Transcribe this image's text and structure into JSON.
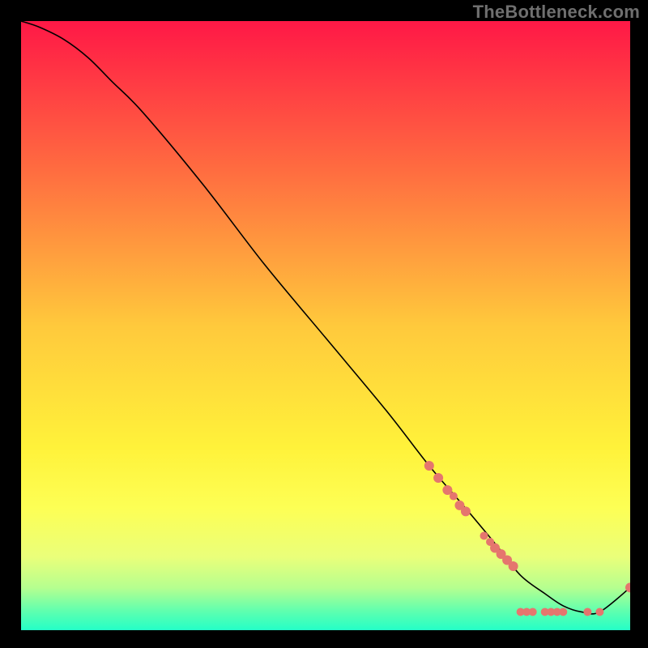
{
  "watermark": "TheBottleneck.com",
  "chart_data": {
    "type": "line",
    "title": "",
    "xlabel": "",
    "ylabel": "",
    "xlim": [
      0,
      100
    ],
    "ylim": [
      0,
      100
    ],
    "grid": false,
    "legend": false,
    "gradient_stops": [
      {
        "offset": 0.0,
        "color": "#ff1846"
      },
      {
        "offset": 0.25,
        "color": "#ff6e40"
      },
      {
        "offset": 0.5,
        "color": "#ffc93c"
      },
      {
        "offset": 0.7,
        "color": "#fff23a"
      },
      {
        "offset": 0.8,
        "color": "#fdff55"
      },
      {
        "offset": 0.88,
        "color": "#eaff7a"
      },
      {
        "offset": 0.93,
        "color": "#b6ff8f"
      },
      {
        "offset": 0.97,
        "color": "#5cffb0"
      },
      {
        "offset": 1.0,
        "color": "#24ffc7"
      }
    ],
    "series": [
      {
        "name": "bottleneck-curve",
        "color": "#000000",
        "x": [
          0,
          3,
          7,
          11,
          15,
          20,
          30,
          40,
          50,
          60,
          67,
          73,
          78,
          82,
          86,
          89,
          92,
          95,
          100
        ],
        "y": [
          100,
          99,
          97,
          94,
          90,
          85,
          73,
          60,
          48,
          36,
          27,
          20,
          14,
          9,
          6,
          4,
          3,
          3,
          7
        ]
      }
    ],
    "markers": {
      "name": "highlighted-points",
      "color": "#e5766e",
      "radius_small": 5,
      "radius_large": 6,
      "points": [
        {
          "x": 67.0,
          "y": 27.0,
          "r": "large"
        },
        {
          "x": 68.5,
          "y": 25.0,
          "r": "large"
        },
        {
          "x": 70.0,
          "y": 23.0,
          "r": "large"
        },
        {
          "x": 71.0,
          "y": 22.0,
          "r": "small"
        },
        {
          "x": 72.0,
          "y": 20.5,
          "r": "large"
        },
        {
          "x": 73.0,
          "y": 19.5,
          "r": "large"
        },
        {
          "x": 76.0,
          "y": 15.5,
          "r": "small"
        },
        {
          "x": 77.0,
          "y": 14.5,
          "r": "small"
        },
        {
          "x": 77.8,
          "y": 13.5,
          "r": "large"
        },
        {
          "x": 78.8,
          "y": 12.5,
          "r": "large"
        },
        {
          "x": 79.8,
          "y": 11.5,
          "r": "large"
        },
        {
          "x": 80.8,
          "y": 10.5,
          "r": "large"
        },
        {
          "x": 82.0,
          "y": 3.0,
          "r": "small"
        },
        {
          "x": 83.0,
          "y": 3.0,
          "r": "small"
        },
        {
          "x": 84.0,
          "y": 3.0,
          "r": "small"
        },
        {
          "x": 86.0,
          "y": 3.0,
          "r": "small"
        },
        {
          "x": 87.0,
          "y": 3.0,
          "r": "small"
        },
        {
          "x": 88.0,
          "y": 3.0,
          "r": "small"
        },
        {
          "x": 89.0,
          "y": 3.0,
          "r": "small"
        },
        {
          "x": 93.0,
          "y": 3.0,
          "r": "small"
        },
        {
          "x": 95.0,
          "y": 3.0,
          "r": "small"
        },
        {
          "x": 100.0,
          "y": 7.0,
          "r": "large"
        }
      ]
    }
  }
}
